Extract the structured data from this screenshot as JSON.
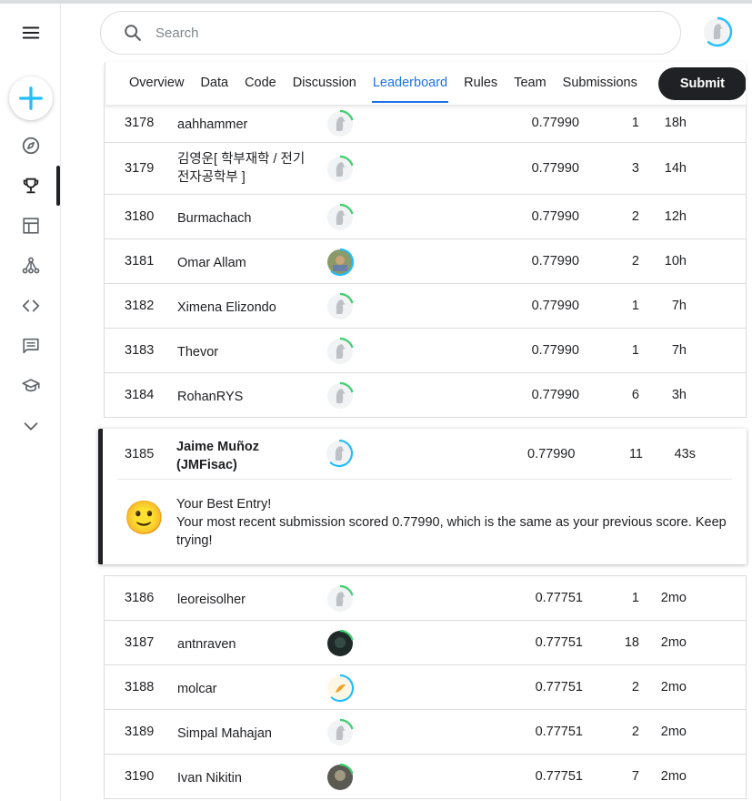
{
  "search": {
    "placeholder": "Search"
  },
  "tabs": [
    {
      "label": "Overview"
    },
    {
      "label": "Data"
    },
    {
      "label": "Code"
    },
    {
      "label": "Discussion"
    },
    {
      "label": "Leaderboard"
    },
    {
      "label": "Rules"
    },
    {
      "label": "Team"
    },
    {
      "label": "Submissions"
    }
  ],
  "submit_label": "Submit",
  "rows_top": [
    {
      "rank": "3178",
      "name": "aahhammer",
      "score": "0.77990",
      "entries": "1",
      "last": "18h"
    },
    {
      "rank": "3179",
      "name": "김영운[ 학부재학 / 전기전자공학부 ]",
      "score": "0.77990",
      "entries": "3",
      "last": "14h"
    },
    {
      "rank": "3180",
      "name": "Burmachach",
      "score": "0.77990",
      "entries": "2",
      "last": "12h"
    },
    {
      "rank": "3181",
      "name": "Omar Allam",
      "score": "0.77990",
      "entries": "2",
      "last": "10h"
    },
    {
      "rank": "3182",
      "name": "Ximena Elizondo",
      "score": "0.77990",
      "entries": "1",
      "last": "7h"
    },
    {
      "rank": "3183",
      "name": "Thevor",
      "score": "0.77990",
      "entries": "1",
      "last": "7h"
    },
    {
      "rank": "3184",
      "name": "RohanRYS",
      "score": "0.77990",
      "entries": "6",
      "last": "3h"
    }
  ],
  "me": {
    "rank": "3185",
    "name": "Jaime Muñoz (JMFisac)",
    "score": "0.77990",
    "entries": "11",
    "last": "43s",
    "emoji": "🙂",
    "msg_title": "Your Best Entry!",
    "msg_body": "Your most recent submission scored 0.77990, which is the same as your previous score. Keep trying!"
  },
  "rows_bottom": [
    {
      "rank": "3186",
      "name": "leoreisolher",
      "score": "0.77751",
      "entries": "1",
      "last": "2mo"
    },
    {
      "rank": "3187",
      "name": "antnraven",
      "score": "0.77751",
      "entries": "18",
      "last": "2mo"
    },
    {
      "rank": "3188",
      "name": "molcar",
      "score": "0.77751",
      "entries": "2",
      "last": "2mo"
    },
    {
      "rank": "3189",
      "name": "Simpal Mahajan",
      "score": "0.77751",
      "entries": "2",
      "last": "2mo"
    },
    {
      "rank": "3190",
      "name": "Ivan Nikitin",
      "score": "0.77751",
      "entries": "7",
      "last": "2mo"
    }
  ],
  "colors": {
    "accent": "#1a73e8",
    "ring_green": "#20beff",
    "progress_green": "#3ccf6e",
    "dark": "#202124"
  },
  "icons": [
    "menu-icon",
    "plus-icon",
    "compass-icon",
    "trophy-icon",
    "table-icon",
    "model-icon",
    "code-icon",
    "discussion-icon",
    "learn-icon",
    "chevron-down-icon",
    "search-icon"
  ]
}
